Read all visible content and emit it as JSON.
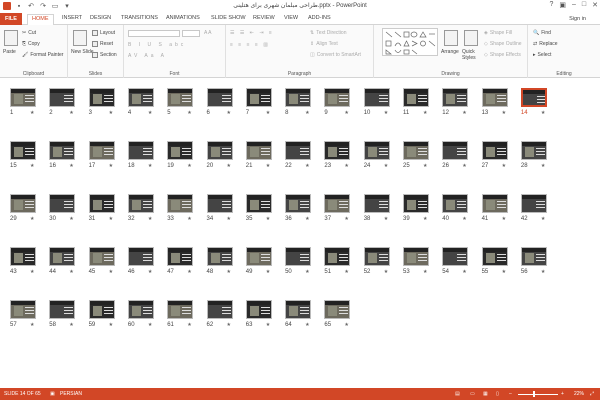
{
  "app": {
    "title": "طراحی مبلمان شهری برای هتلینی.pptx - PowerPoint",
    "signin": "Sign in"
  },
  "tabs": {
    "file": "FILE",
    "home": "HOME",
    "insert": "INSERT",
    "design": "DESIGN",
    "transitions": "TRANSITIONS",
    "animations": "ANIMATIONS",
    "slideshow": "SLIDE SHOW",
    "review": "REVIEW",
    "view": "VIEW",
    "addins": "ADD-INS"
  },
  "ribbon": {
    "clipboard": {
      "label": "Clipboard",
      "paste": "Paste",
      "cut": "Cut",
      "copy": "Copy",
      "format_painter": "Format Painter"
    },
    "slides": {
      "label": "Slides",
      "new_slide": "New Slide",
      "layout": "Layout",
      "reset": "Reset",
      "section": "Section"
    },
    "font": {
      "label": "Font"
    },
    "paragraph": {
      "label": "Paragraph",
      "text_direction": "Text Direction",
      "align_text": "Align Text",
      "convert": "Convert to SmartArt"
    },
    "drawing": {
      "label": "Drawing",
      "arrange": "Arrange",
      "quick_styles": "Quick Styles",
      "shape_fill": "Shape Fill",
      "shape_outline": "Shape Outline",
      "shape_effects": "Shape Effects"
    },
    "editing": {
      "label": "Editing",
      "find": "Find",
      "replace": "Replace",
      "select": "Select"
    }
  },
  "slide_count": 65,
  "selected_slide": 14,
  "status": {
    "slide_info": "SLIDE 14 OF 65",
    "language": "PERSIAN",
    "zoom": "22%"
  }
}
